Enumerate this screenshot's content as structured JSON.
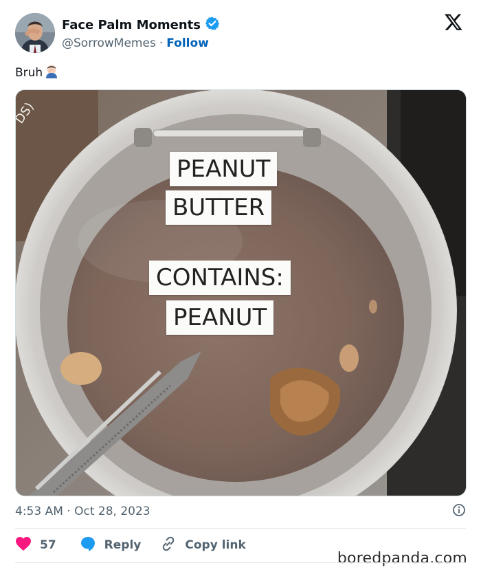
{
  "author": {
    "display_name": "Face Palm Moments",
    "handle": "@SorrowMemes",
    "separator": "·",
    "follow_label": "Follow",
    "verified": true,
    "avatar_icon": "person-facepalm-avatar"
  },
  "tweet": {
    "text": "Bruh",
    "emoji": "🤦🏻‍♂️",
    "timestamp": "4:53 AM · Oct 28, 2023"
  },
  "media": {
    "signs": [
      {
        "text": "PEANUT"
      },
      {
        "text": "BUTTER"
      },
      {
        "text": "CONTAINS:"
      },
      {
        "text": "PEANUT"
      }
    ],
    "corner_text": "DS)"
  },
  "actions": {
    "like_count": "57",
    "reply_label": "Reply",
    "copy_label": "Copy link"
  },
  "watermark": {
    "text": "boredpanda.com"
  },
  "colors": {
    "verified_blue": "#1d9bf0",
    "follow_blue": "#0062b8",
    "like_pink": "#f91880",
    "reply_blue": "#1d9bf0",
    "muted": "#536471"
  }
}
